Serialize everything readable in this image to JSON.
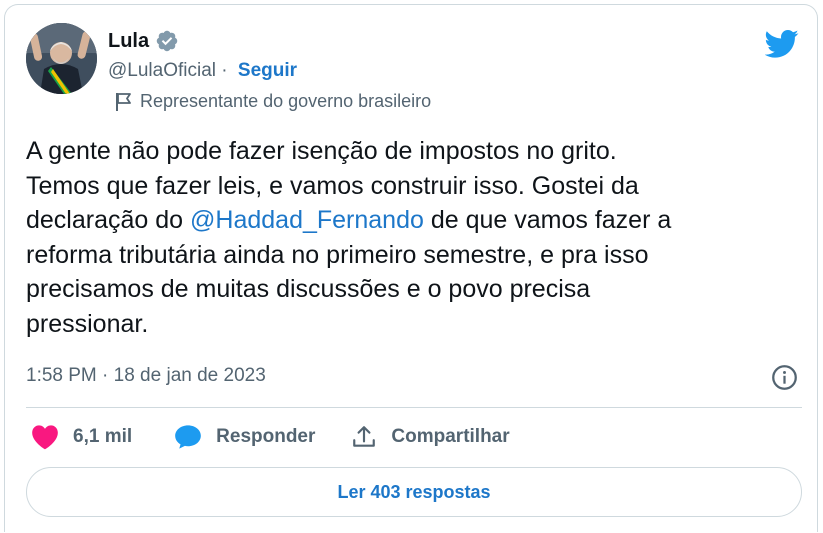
{
  "author": {
    "name": "Lula",
    "handle": "@LulaOficial",
    "separator": " · ",
    "follow_label": "Seguir",
    "account_label": "Representante do governo brasileiro"
  },
  "tweet": {
    "text_before": "A gente não pode fazer isenção de impostos no grito.\nTemos que fazer leis, e vamos construir isso. Gostei da\ndeclaração do ",
    "mention": "@Haddad_Fernando",
    "text_after": " de que vamos fazer a\nreforma tributária ainda no primeiro semestre, e pra isso\nprecisamos de muitas discussões e o povo precisa\npressionar.",
    "timestamp": "1:58 PM · 18 de jan de 2023"
  },
  "actions": {
    "likes": "6,1 mil",
    "reply_label": "Responder",
    "share_label": "Compartilhar"
  },
  "replies_button": "Ler 403 respostas",
  "icons": [
    "verified-badge-icon",
    "twitter-bird-icon",
    "flag-icon",
    "info-icon",
    "heart-icon",
    "reply-icon",
    "share-icon"
  ],
  "colors": {
    "accent": "#1d77c9",
    "twitter_blue": "#1d9bf0",
    "heart": "#f91880",
    "secondary_text": "#536471",
    "border": "#cfd9de"
  }
}
